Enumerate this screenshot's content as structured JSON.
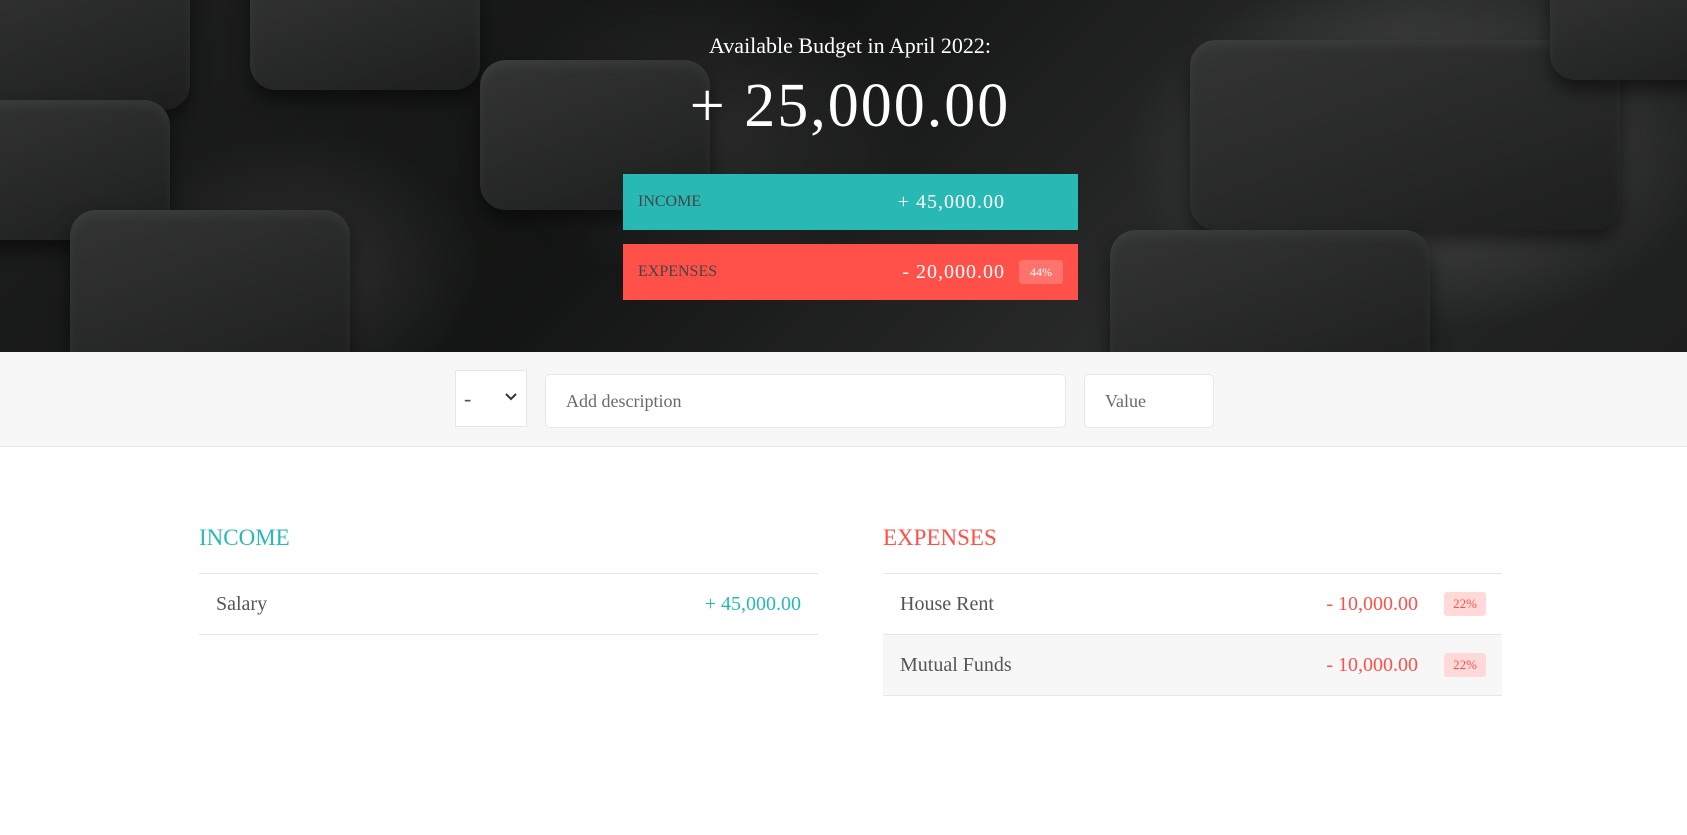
{
  "header": {
    "title": "Available Budget in April 2022:",
    "budget_value": "+ 25,000.00",
    "income": {
      "label": "Income",
      "value": "+ 45,000.00"
    },
    "expenses": {
      "label": "Expenses",
      "value": "- 20,000.00",
      "percentage": "44%"
    }
  },
  "add_form": {
    "type_selected": "-",
    "description_placeholder": "Add description",
    "value_placeholder": "Value"
  },
  "income_list": {
    "title": "Income",
    "items": [
      {
        "description": "Salary",
        "value": "+ 45,000.00"
      }
    ]
  },
  "expenses_list": {
    "title": "Expenses",
    "items": [
      {
        "description": "House Rent",
        "value": "- 10,000.00",
        "percentage": "22%"
      },
      {
        "description": "Mutual Funds",
        "value": "- 10,000.00",
        "percentage": "22%"
      }
    ]
  },
  "colors": {
    "income_accent": "#28B9B5",
    "expense_accent": "#FF5049"
  }
}
